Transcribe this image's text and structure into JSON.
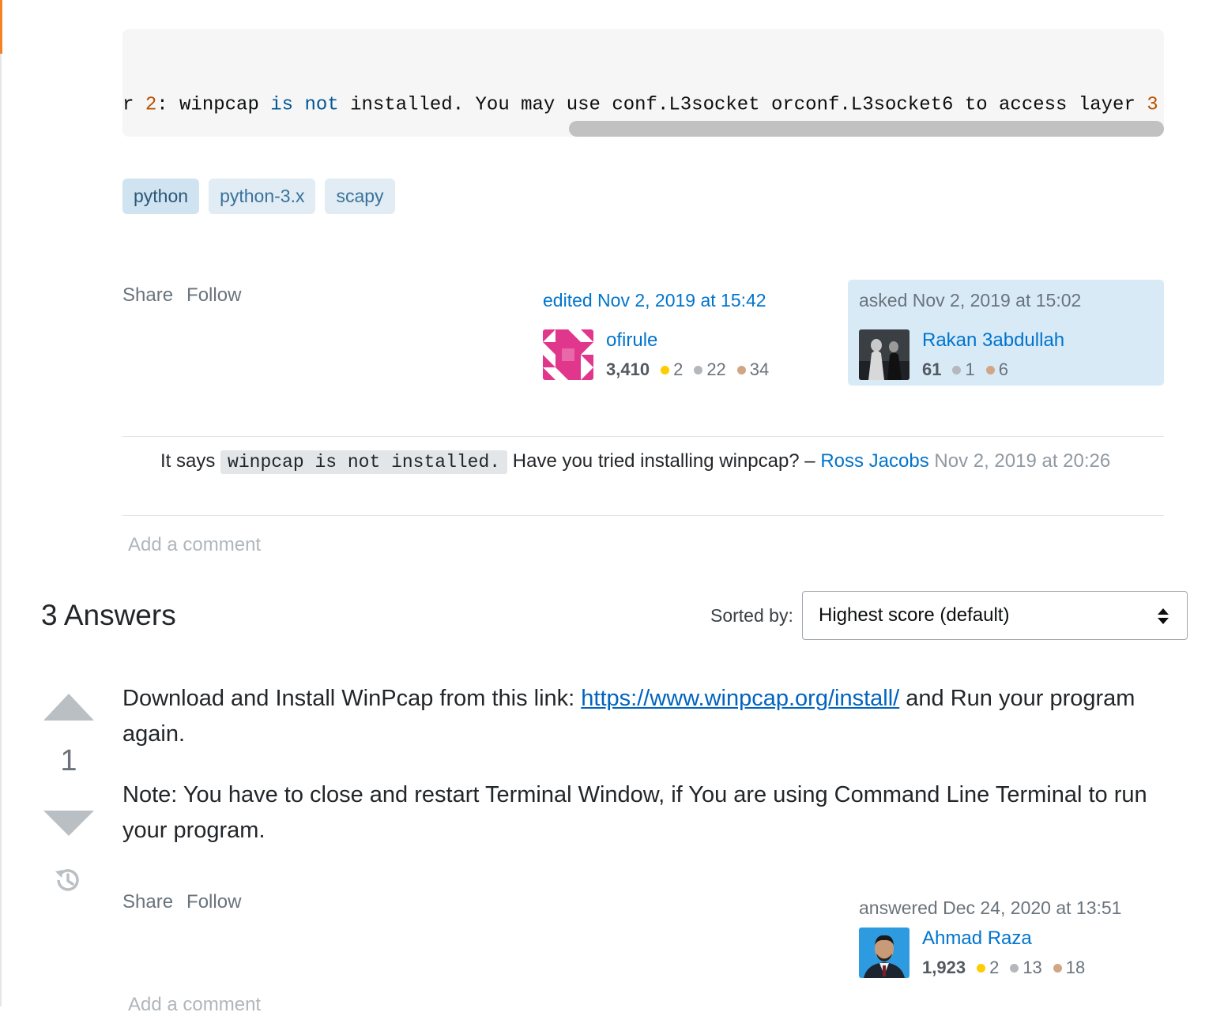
{
  "code": {
    "cut_prefix": "r",
    "num1": "2",
    "seg1": ": winpcap ",
    "kw1": "is",
    "kw2": "not",
    "seg2": " installed. You may use conf.L3socket orconf.L3socket6 to access layer ",
    "num2": "3"
  },
  "tags": [
    "python",
    "python-3.x",
    "scapy"
  ],
  "question": {
    "menu": {
      "share": "Share",
      "follow": "Follow"
    },
    "edited": {
      "when": "edited Nov 2, 2019 at 15:42",
      "user": "ofirule",
      "rep": "3,410",
      "gold": "2",
      "silver": "22",
      "bronze": "34"
    },
    "asked": {
      "when": "asked Nov 2, 2019 at 15:02",
      "user": "Rakan 3abdullah",
      "rep": "61",
      "silver": "1",
      "bronze": "6"
    }
  },
  "comment": {
    "pre": "It says ",
    "code": "winpcap is not installed.",
    "post": " Have you tried installing winpcap? – ",
    "user": "Ross Jacobs",
    "date": "Nov 2, 2019 at 20:26"
  },
  "add_comment": "Add a comment",
  "answers": {
    "count_label": "3 Answers",
    "sort_label": "Sorted by:",
    "sort_value": "Highest score (default)"
  },
  "answer": {
    "score": "1",
    "p1_pre": "Download and Install WinPcap from this link: ",
    "p1_link": "https://www.winpcap.org/install/",
    "p1_post": " and Run your program again.",
    "p2": "Note: You have to close and restart Terminal Window, if You are using Command Line Terminal to run your program.",
    "menu": {
      "share": "Share",
      "follow": "Follow"
    },
    "answered": {
      "when": "answered Dec 24, 2020 at 13:51",
      "user": "Ahmad Raza",
      "rep": "1,923",
      "gold": "2",
      "silver": "13",
      "bronze": "18"
    }
  }
}
